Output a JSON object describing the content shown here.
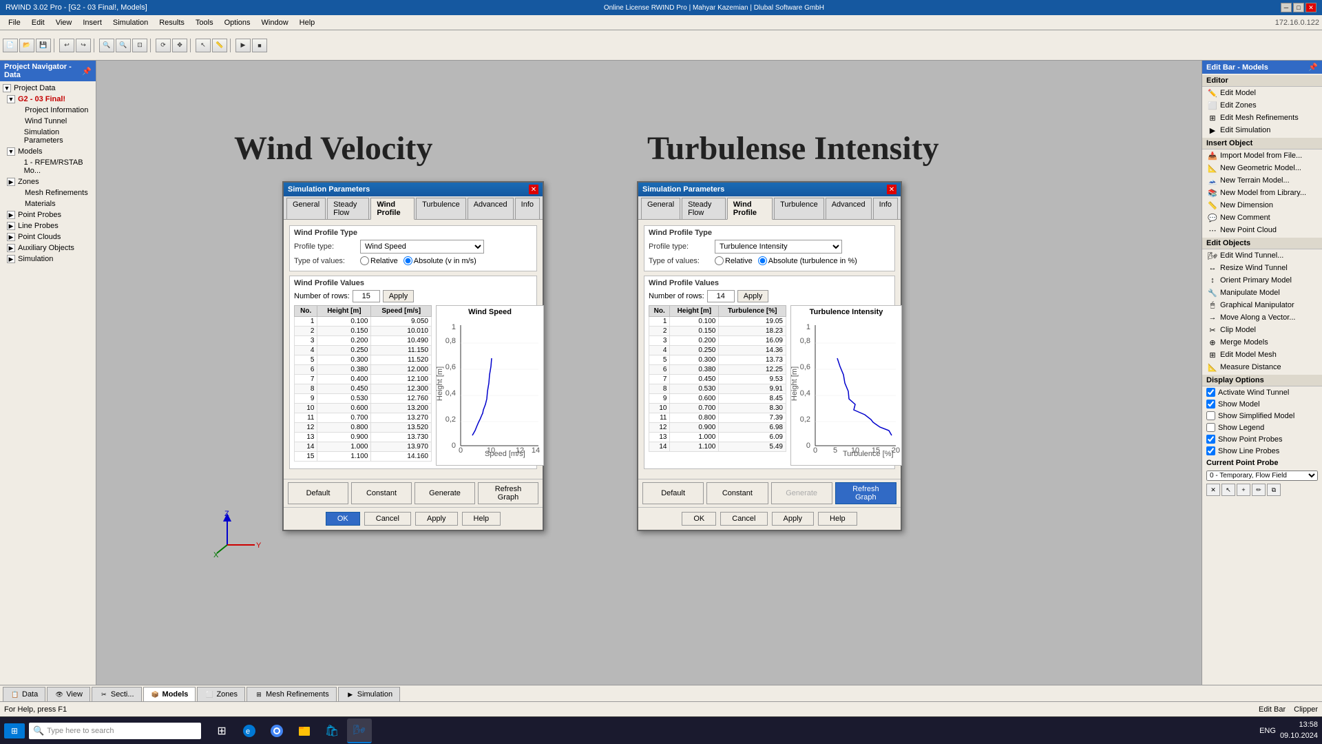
{
  "app": {
    "title": "RWIND 3.02 Pro - [G2 - 03 Final!, Models]",
    "license": "Online License RWIND Pro | Mahyar Kazemian | Dlubal Software GmbH",
    "ip": "172.16.0.122"
  },
  "menu": {
    "items": [
      "File",
      "Edit",
      "View",
      "Insert",
      "Simulation",
      "Results",
      "Tools",
      "Options",
      "Window",
      "Help"
    ]
  },
  "sidebar_left": {
    "header": "Project Navigator - Data",
    "tree": [
      {
        "label": "Project Data",
        "indent": 0,
        "expand": true
      },
      {
        "label": "G2 - 03 Final!",
        "indent": 1,
        "expand": true,
        "icon": "folder"
      },
      {
        "label": "Project Information",
        "indent": 2,
        "icon": "doc"
      },
      {
        "label": "Wind Tunnel",
        "indent": 2,
        "icon": "tunnel"
      },
      {
        "label": "Simulation Parameters",
        "indent": 2,
        "icon": "params"
      },
      {
        "label": "Models",
        "indent": 1,
        "expand": true,
        "icon": "folder"
      },
      {
        "label": "1 - RFEM/RSTAB Mo...",
        "indent": 2,
        "icon": "model"
      },
      {
        "label": "Zones",
        "indent": 1,
        "expand": false,
        "icon": "folder"
      },
      {
        "label": "Mesh Refinements",
        "indent": 2,
        "icon": "mesh"
      },
      {
        "label": "Materials",
        "indent": 2,
        "icon": "mat"
      },
      {
        "label": "Point Probes",
        "indent": 1,
        "expand": false,
        "icon": "probe"
      },
      {
        "label": "Line Probes",
        "indent": 1,
        "expand": false,
        "icon": "probe"
      },
      {
        "label": "Point Clouds",
        "indent": 1,
        "expand": false,
        "icon": "cloud"
      },
      {
        "label": "Auxiliary Objects",
        "indent": 1,
        "expand": false,
        "icon": "obj"
      },
      {
        "label": "Simulation",
        "indent": 1,
        "expand": false,
        "icon": "sim"
      }
    ]
  },
  "sidebar_right": {
    "header": "Edit Bar - Models",
    "editor_label": "Editor",
    "editor_items": [
      "Edit Model",
      "Edit Zones",
      "Edit Mesh Refinements",
      "Edit Simulation"
    ],
    "insert_label": "Insert Object",
    "insert_items": [
      "Import Model from File...",
      "New Geometric Model...",
      "New Terrain Model...",
      "New Model from Library...",
      "New Dimension",
      "New Comment",
      "New Point Cloud"
    ],
    "edit_label": "Edit Objects",
    "edit_items": [
      "Edit Wind Tunnel...",
      "Resize Wind Tunnel",
      "Orient Primary Model",
      "Manipulate Model",
      "Graphical Manipulator",
      "Move Along a Vector...",
      "Clip Model",
      "Merge Models",
      "Edit Model Mesh",
      "Measure Distance"
    ],
    "display_label": "Display Options",
    "display_items": [
      {
        "label": "Activate Wind Tunnel",
        "checked": true
      },
      {
        "label": "Show Model",
        "checked": true
      },
      {
        "label": "Show Simplified Model",
        "checked": false
      },
      {
        "label": "Show Legend",
        "checked": false
      },
      {
        "label": "Show Point Probes",
        "checked": true
      },
      {
        "label": "Show Line Probes",
        "checked": true
      }
    ],
    "probe_label": "Current Point Probe",
    "probe_value": "0 - Temporary, Flow Field"
  },
  "viewport": {
    "title_wind": "Wind Velocity",
    "title_turb": "Turbulense Intensity"
  },
  "dialog_wind": {
    "title": "Simulation Parameters",
    "tabs": [
      "General",
      "Steady Flow",
      "Wind Profile",
      "Turbulence",
      "Advanced",
      "Info"
    ],
    "active_tab": "Wind Profile",
    "profile_type_label": "Profile type:",
    "profile_type_value": "Wind Speed",
    "values_label": "Type of values:",
    "relative_label": "Relative",
    "absolute_label": "Absolute (v in m/s)",
    "absolute_selected": true,
    "num_rows_label": "Number of rows:",
    "num_rows_value": "15",
    "apply_label": "Apply",
    "chart_title": "Wind Speed",
    "chart_xlabel": "Speed [m/s]",
    "chart_ylabel": "Height [m]",
    "table_headers": [
      "No.",
      "Height [m]",
      "Speed [m/s]"
    ],
    "table_data": [
      [
        1,
        0.1,
        9.05
      ],
      [
        2,
        0.15,
        10.01
      ],
      [
        3,
        0.2,
        10.49
      ],
      [
        4,
        0.25,
        11.15
      ],
      [
        5,
        0.3,
        11.52
      ],
      [
        6,
        0.38,
        12.0
      ],
      [
        7,
        0.4,
        12.1
      ],
      [
        8,
        0.45,
        12.3
      ],
      [
        9,
        0.53,
        12.76
      ],
      [
        10,
        0.6,
        13.2
      ],
      [
        11,
        0.7,
        13.27
      ],
      [
        12,
        0.8,
        13.52
      ],
      [
        13,
        0.9,
        13.73
      ],
      [
        14,
        1.0,
        13.97
      ],
      [
        15,
        1.1,
        14.16
      ]
    ],
    "buttons": {
      "default": "Default",
      "constant": "Constant",
      "generate": "Generate",
      "refresh": "Refresh Graph"
    },
    "footer": {
      "ok": "OK",
      "cancel": "Cancel",
      "apply": "Apply",
      "help": "Help"
    }
  },
  "dialog_turb": {
    "title": "Simulation Parameters",
    "tabs": [
      "General",
      "Steady Flow",
      "Wind Profile",
      "Turbulence",
      "Advanced",
      "Info"
    ],
    "active_tab": "Wind Profile",
    "profile_type_label": "Profile type:",
    "profile_type_value": "Turbulence Intensity",
    "values_label": "Type of values:",
    "relative_label": "Relative",
    "absolute_label": "Absolute (turbulence in %)",
    "absolute_selected": true,
    "num_rows_label": "Number of rows:",
    "num_rows_value": "14",
    "apply_label": "Apply",
    "chart_title": "Turbulence Intensity",
    "chart_xlabel": "Turbulence [%]",
    "chart_ylabel": "Height [m]",
    "table_headers": [
      "No.",
      "Height [m]",
      "Turbulence [%]"
    ],
    "table_data": [
      [
        1,
        0.1,
        19.05
      ],
      [
        2,
        0.15,
        18.23
      ],
      [
        3,
        0.2,
        16.09
      ],
      [
        4,
        0.25,
        14.36
      ],
      [
        5,
        0.3,
        13.73
      ],
      [
        6,
        0.38,
        12.25
      ],
      [
        7,
        0.45,
        9.53
      ],
      [
        8,
        0.53,
        9.91
      ],
      [
        9,
        0.6,
        8.45
      ],
      [
        10,
        0.7,
        8.3
      ],
      [
        11,
        0.8,
        7.39
      ],
      [
        12,
        0.9,
        6.98
      ],
      [
        13,
        1.0,
        6.09
      ],
      [
        14,
        1.1,
        5.49
      ]
    ],
    "buttons": {
      "default": "Default",
      "constant": "Constant",
      "generate": "Generate",
      "refresh": "Refresh Graph"
    },
    "footer": {
      "ok": "OK",
      "cancel": "Cancel",
      "apply": "Apply",
      "help": "Help"
    }
  },
  "bottom_tabs": [
    {
      "label": "Data",
      "active": false
    },
    {
      "label": "View",
      "active": false
    },
    {
      "label": "Secti...",
      "active": false
    },
    {
      "label": "Models",
      "active": true
    },
    {
      "label": "Zones",
      "active": false
    },
    {
      "label": "Mesh Refinements",
      "active": false
    },
    {
      "label": "Simulation",
      "active": false
    }
  ],
  "status_bar": {
    "message": "For Help, press F1"
  },
  "taskbar": {
    "time": "13:58",
    "date": "09.10.2024",
    "search_placeholder": "Type here to search",
    "lang": "ENG"
  }
}
